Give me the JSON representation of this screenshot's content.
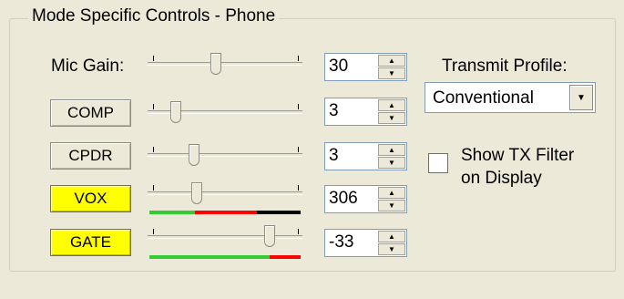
{
  "group": {
    "title": "Mode Specific Controls - Phone"
  },
  "mic_gain": {
    "label": "Mic Gain:",
    "value": "30"
  },
  "comp": {
    "label": "COMP",
    "value": "3"
  },
  "cpdr": {
    "label": "CPDR",
    "value": "3"
  },
  "vox": {
    "label": "VOX",
    "value": "306"
  },
  "gate": {
    "label": "GATE",
    "value": "-33"
  },
  "transmit_profile": {
    "label": "Transmit Profile:",
    "selected": "Conventional"
  },
  "show_tx_filter": {
    "label_line1": "Show TX Filter",
    "label_line2": "on Display",
    "checked": false
  },
  "colors": {
    "panel_bg": "#ece9d8",
    "active_button": "#ffff00",
    "meter_green": "#33cc33",
    "meter_red": "#ff0000",
    "meter_black": "#000000"
  },
  "icons": {
    "spin_up": "spin-up-arrow-icon",
    "spin_down": "spin-down-arrow-icon",
    "dropdown": "dropdown-arrow-icon"
  }
}
